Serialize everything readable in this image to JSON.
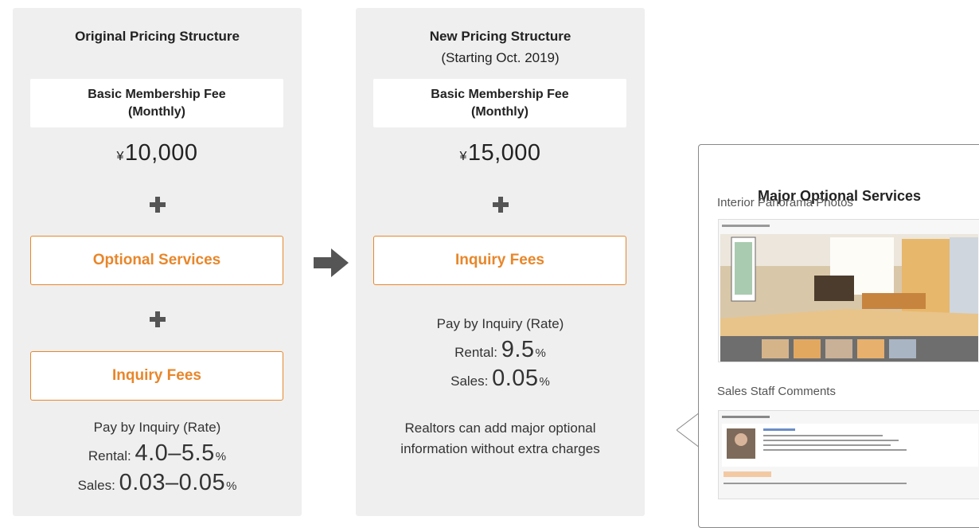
{
  "left_column": {
    "title": "Original Pricing Structure",
    "fee_label": "Basic Membership Fee\n(Monthly)",
    "price_currency": "¥",
    "price_amount": "10,000",
    "optional_box": "Optional Services",
    "inquiry_box": "Inquiry Fees",
    "pay_label": "Pay by Inquiry (Rate)",
    "rental_label": "Rental: ",
    "rental_value": "4.0–5.5",
    "rental_unit": "%",
    "sales_label": "Sales: ",
    "sales_value": "0.03–0.05",
    "sales_unit": "%"
  },
  "middle_column": {
    "title": "New Pricing Structure",
    "subtitle": "(Starting Oct. 2019)",
    "fee_label": "Basic Membership Fee\n(Monthly)",
    "price_currency": "¥",
    "price_amount": "15,000",
    "inquiry_box": "Inquiry Fees",
    "pay_label": "Pay by Inquiry (Rate)",
    "rental_label": "Rental: ",
    "rental_value": "9.5",
    "rental_unit": "%",
    "sales_label": "Sales: ",
    "sales_value": "0.05",
    "sales_unit": "%",
    "note": "Realtors can add major optional information without extra charges"
  },
  "panel": {
    "title": "Major Optional Services",
    "item1_label": "Interior Panorama Photos",
    "item2_label": "Sales Staff Comments"
  },
  "icons": [
    "right-arrow-icon",
    "plus-icon"
  ],
  "colors": {
    "accent": "#e8862a",
    "column_bg": "#efefef",
    "icon": "#555555"
  }
}
